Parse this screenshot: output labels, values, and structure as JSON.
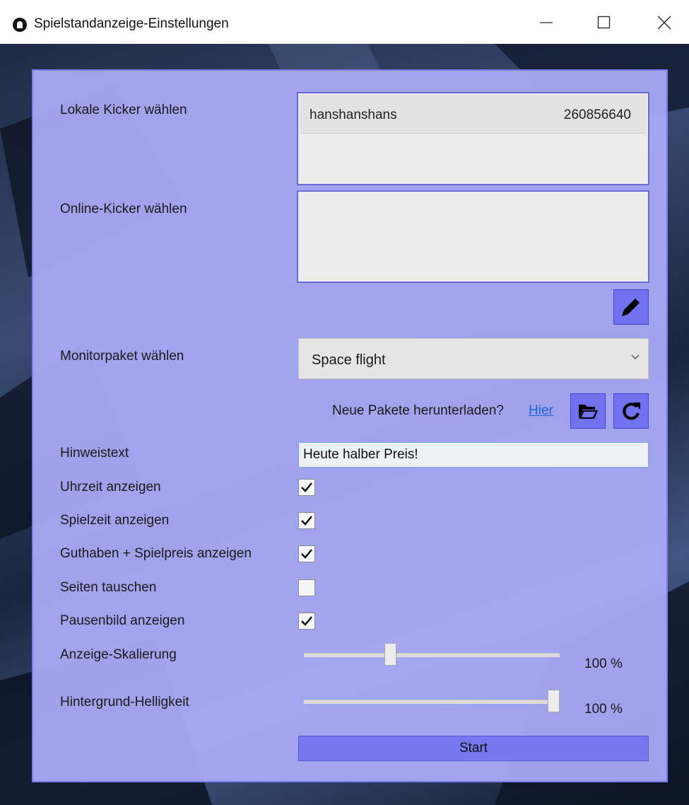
{
  "window": {
    "title": "Spielstandanzeige-Einstellungen",
    "minimize_icon": "minimize-icon",
    "maximize_icon": "maximize-icon",
    "close_icon": "close-icon"
  },
  "form": {
    "local_kicker_label": "Lokale Kicker wählen",
    "local_kickers": [
      {
        "name": "hanshanshans",
        "id": "260856640"
      }
    ],
    "online_kicker_label": "Online-Kicker wählen",
    "edit_icon": "pencil-icon",
    "monitor_label": "Monitorpaket wählen",
    "monitor_value": "Space flight",
    "download_text": "Neue Pakete herunterladen?",
    "download_link": "Hier",
    "folder_icon": "folder-open-icon",
    "refresh_icon": "refresh-icon",
    "hint_label": "Hinweistext",
    "hint_value": "Heute halber Preis!",
    "checkboxes": [
      {
        "label": "Uhrzeit anzeigen",
        "checked": true
      },
      {
        "label": "Spielzeit anzeigen",
        "checked": true
      },
      {
        "label": "Guthaben + Spielpreis anzeigen",
        "checked": true
      },
      {
        "label": "Seiten tauschen",
        "checked": false
      },
      {
        "label": "Pausenbild anzeigen",
        "checked": true
      }
    ],
    "scale_label": "Anzeige-Skalierung",
    "scale_value": "100 %",
    "scale_slider_fraction": 0.33,
    "brightness_label": "Hintergrund-Helligkeit",
    "brightness_value": "100 %",
    "brightness_slider_fraction": 1.0,
    "start_label": "Start"
  },
  "colors": {
    "panel": "#acacfa",
    "accent": "#7272f0",
    "link": "#1f5fd6"
  }
}
